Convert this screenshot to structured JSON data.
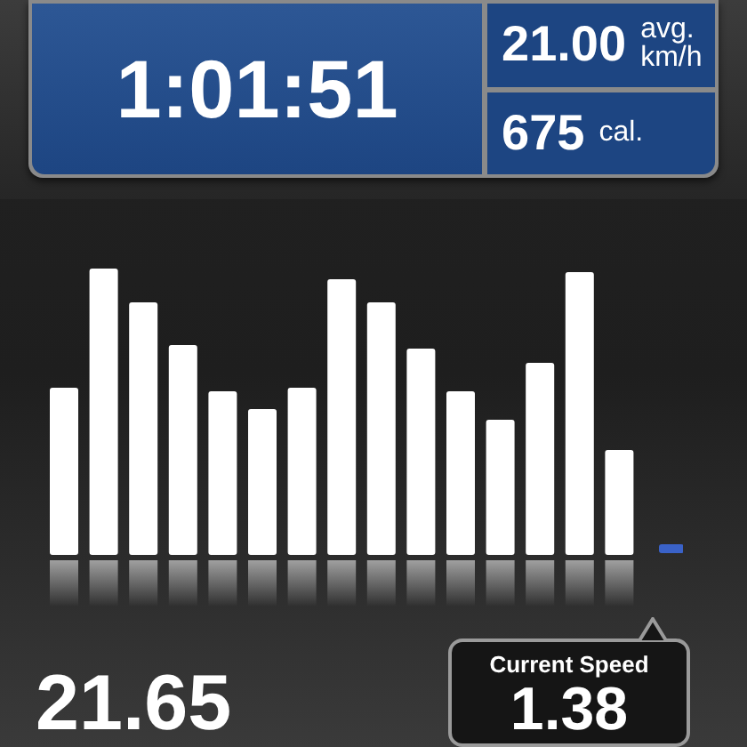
{
  "timer": {
    "elapsed": "1:01:51"
  },
  "stats": [
    {
      "value": "21.00",
      "unit": "avg.\nkm/h"
    },
    {
      "value": "675",
      "unit": "cal."
    }
  ],
  "distance": {
    "value": "21.65"
  },
  "current_speed": {
    "label": "Current Speed",
    "value": "1.38"
  }
}
